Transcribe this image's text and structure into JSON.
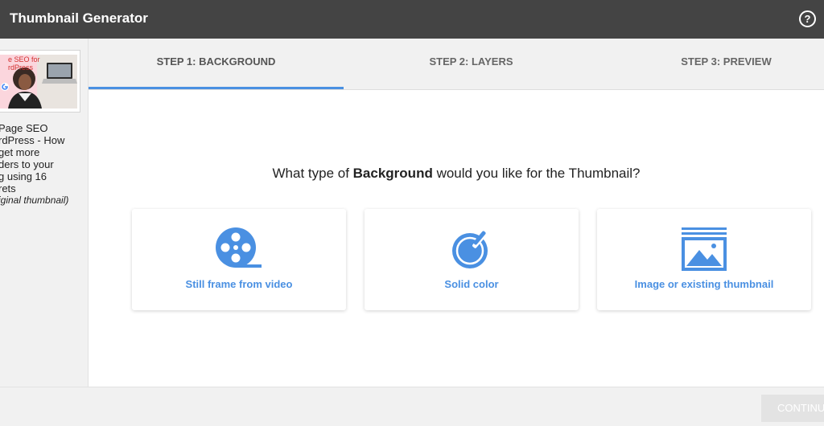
{
  "app": {
    "title": "Thumbnail Generator",
    "help_glyph": "?"
  },
  "sidebar": {
    "thumbnail_text": "e SEO for\nrdPress",
    "description": "Page SEO\nrdPress - How\nget more\nders to your\ng using 16\nrets",
    "note": "iginal thumbnail)"
  },
  "tabs": [
    {
      "label": "STEP 1: BACKGROUND",
      "active": true
    },
    {
      "label": "STEP 2: LAYERS",
      "active": false
    },
    {
      "label": "STEP 3: PREVIEW",
      "active": false
    }
  ],
  "question": {
    "before": "What type of ",
    "emphasis": "Background",
    "after": " would you like for the Thumbnail?"
  },
  "options": [
    {
      "label": "Still frame from video",
      "icon": "film-reel-icon"
    },
    {
      "label": "Solid color",
      "icon": "color-picker-icon"
    },
    {
      "label": "Image or existing thumbnail",
      "icon": "image-stack-icon"
    }
  ],
  "footer": {
    "continue_label": "CONTINUE"
  },
  "colors": {
    "accent": "#4a90e2",
    "titlebar": "#444444",
    "panel": "#f1f1f1"
  }
}
